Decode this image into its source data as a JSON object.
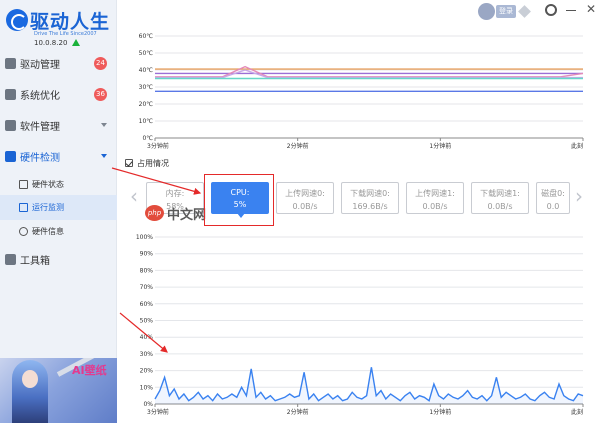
{
  "app": {
    "name": "驱动人生",
    "slogan": "Drive The Life  Since2007",
    "version": "10.0.8.20"
  },
  "topbar": {
    "login_label": "登录"
  },
  "sidebar": {
    "items": [
      {
        "label": "驱动管理",
        "icon": "wrench-icon",
        "badge": "24"
      },
      {
        "label": "系统优化",
        "icon": "rocket-icon",
        "badge": "36"
      },
      {
        "label": "软件管理",
        "icon": "box-icon"
      },
      {
        "label": "硬件检测",
        "icon": "chip-icon",
        "active": true
      },
      {
        "label": "工具箱",
        "icon": "toolbox-icon"
      }
    ],
    "subitems": [
      {
        "label": "硬件状态",
        "icon": "pulse-icon"
      },
      {
        "label": "运行监测",
        "icon": "monitor-icon",
        "active": true
      },
      {
        "label": "硬件信息",
        "icon": "info-icon"
      }
    ],
    "promo_text": "AI壁纸"
  },
  "usage": {
    "header": "占用情况",
    "cards": [
      {
        "label": "内存:",
        "value": "58%"
      },
      {
        "label": "CPU:",
        "value": "5%",
        "active": true
      },
      {
        "label": "上传网速0:",
        "value": "0.0B/s"
      },
      {
        "label": "下载网速0:",
        "value": "169.6B/s"
      },
      {
        "label": "上传网速1:",
        "value": "0.0B/s"
      },
      {
        "label": "下载网速1:",
        "value": "0.0B/s"
      },
      {
        "label": "磁盘0:",
        "value": "0.0"
      }
    ]
  },
  "watermark": {
    "logo": "php",
    "text": "中文网"
  },
  "colors": {
    "accent": "#3a82f0",
    "brand": "#1a64d4",
    "badge": "#ef5b5b",
    "annotation": "#e42a2a"
  },
  "chart_data": [
    {
      "type": "line",
      "x_ticks": [
        "3分钟前",
        "2分钟前",
        "1分钟前",
        "此刻"
      ],
      "y_ticks": [
        "0℃",
        "10℃",
        "20℃",
        "30℃",
        "40℃",
        "50℃",
        "60℃"
      ],
      "ylim": [
        0,
        60
      ],
      "grid": true,
      "series": [
        {
          "color": "#e8a060",
          "values": [
            40.5,
            40.5,
            40.5,
            40.5,
            40.5,
            40.5,
            40.5,
            40.5,
            40.5,
            40.5,
            40.5,
            40.5,
            40.5,
            40.5,
            40.5,
            40.5,
            40.5,
            40.5,
            40.5,
            40.5
          ]
        },
        {
          "color": "#9b6fd6",
          "values": [
            38,
            38,
            38,
            38,
            38,
            38,
            38,
            38,
            38,
            38,
            38,
            38,
            38,
            38,
            38,
            38,
            38,
            38,
            38,
            38
          ]
        },
        {
          "color": "#e48ab8",
          "values": [
            36,
            36,
            36,
            36,
            42,
            36,
            36,
            36,
            36,
            36,
            36,
            36,
            36,
            36,
            36,
            36,
            36,
            36,
            36,
            38
          ]
        },
        {
          "color": "#c9a8e8",
          "values": [
            35.5,
            35.5,
            35.5,
            35.5,
            40,
            35.5,
            35.5,
            35.5,
            35.5,
            35.5,
            35.5,
            35.5,
            35.5,
            35.5,
            35.5,
            35.5,
            35.5,
            35.5,
            35.5,
            35.5
          ]
        },
        {
          "color": "#66d8c8",
          "values": [
            35,
            35,
            35,
            35,
            35,
            35,
            35,
            35,
            35,
            35,
            35,
            35,
            35,
            35,
            35,
            35,
            35,
            35,
            35,
            35
          ]
        },
        {
          "color": "#5a78e6",
          "values": [
            27.5,
            27.5,
            27.5,
            27.5,
            27.5,
            27.5,
            27.5,
            27.5,
            27.5,
            27.5,
            27.5,
            27.5,
            27.5,
            27.5,
            27.5,
            27.5,
            27.5,
            27.5,
            27.5,
            27.5
          ]
        }
      ]
    },
    {
      "type": "area",
      "x_ticks": [
        "3分钟前",
        "2分钟前",
        "1分钟前",
        "此刻"
      ],
      "y_ticks": [
        "0%",
        "10%",
        "20%",
        "30%",
        "40%",
        "50%",
        "60%",
        "70%",
        "80%",
        "90%",
        "100%"
      ],
      "ylim": [
        0,
        100
      ],
      "grid": true,
      "series": [
        {
          "color": "#3a82f0",
          "values": [
            3,
            8,
            16,
            5,
            9,
            3,
            6,
            2,
            4,
            7,
            3,
            5,
            2,
            6,
            3,
            4,
            6,
            4,
            10,
            5,
            21,
            4,
            7,
            3,
            5,
            2,
            3,
            4,
            6,
            4,
            5,
            19,
            3,
            6,
            2,
            4,
            6,
            3,
            5,
            2,
            3,
            7,
            4,
            3,
            5,
            22,
            5,
            8,
            3,
            6,
            4,
            2,
            5,
            7,
            3,
            5,
            4,
            2,
            12,
            5,
            3,
            6,
            4,
            3,
            5,
            8,
            4,
            3,
            5,
            2,
            5,
            16,
            4,
            7,
            5,
            3,
            4,
            6,
            3,
            2,
            5,
            7,
            4,
            3,
            12,
            5,
            3,
            2,
            6,
            5
          ]
        }
      ]
    }
  ]
}
